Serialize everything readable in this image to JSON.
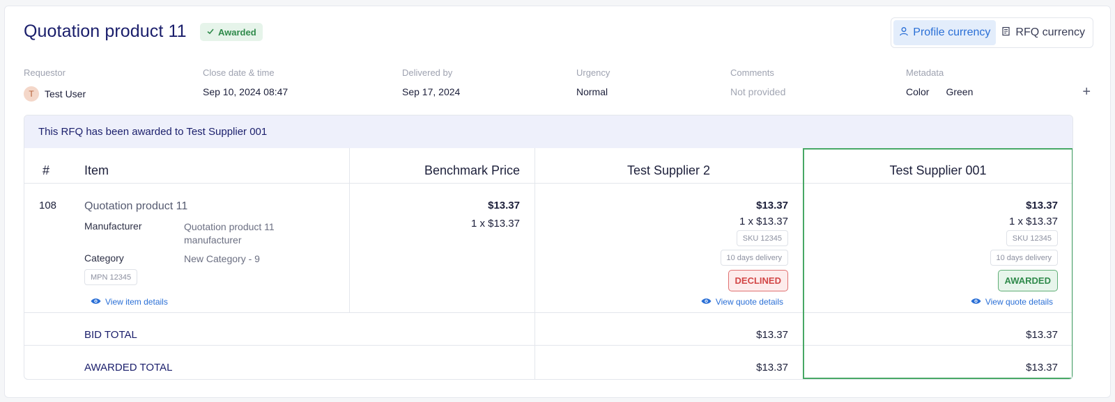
{
  "header": {
    "title": "Quotation product 11",
    "status_badge": "Awarded",
    "currency_toggle": {
      "profile": "Profile currency",
      "rfq": "RFQ currency"
    }
  },
  "meta": {
    "requestor": {
      "label": "Requestor",
      "avatar_initial": "T",
      "value": "Test User"
    },
    "close_date": {
      "label": "Close date & time",
      "value": "Sep 10, 2024 08:47"
    },
    "delivered_by": {
      "label": "Delivered by",
      "value": "Sep 17, 2024"
    },
    "urgency": {
      "label": "Urgency",
      "value": "Normal"
    },
    "comments": {
      "label": "Comments",
      "value": "Not provided"
    },
    "metadata": {
      "label": "Metadata",
      "key": "Color",
      "value": "Green",
      "add": "+"
    }
  },
  "banner": "This RFQ has been awarded to Test Supplier 001",
  "table": {
    "headers": {
      "num": "#",
      "item": "Item",
      "benchmark": "Benchmark Price",
      "supplier_a": "Test Supplier 2",
      "supplier_b": "Test Supplier 001"
    },
    "row": {
      "num": "108",
      "item_name": "Quotation product 11",
      "manufacturer_label": "Manufacturer",
      "manufacturer_line1": "Quotation product 11",
      "manufacturer_line2": "manufacturer",
      "category_label": "Category",
      "category_value": "New Category - 9",
      "mpn": "MPN 12345",
      "view_item": "View item details",
      "benchmark": {
        "price": "$13.37",
        "qty": "1 x $13.37"
      },
      "supplier_a": {
        "price": "$13.37",
        "qty": "1 x $13.37",
        "sku": "SKU 12345",
        "delivery": "10 days delivery",
        "status": "DECLINED",
        "view": "View quote details"
      },
      "supplier_b": {
        "price": "$13.37",
        "qty": "1 x $13.37",
        "sku": "SKU 12345",
        "delivery": "10 days delivery",
        "status": "AWARDED",
        "view": "View quote details"
      }
    },
    "bid_total": {
      "label": "BID TOTAL",
      "supplier_a": "$13.37",
      "supplier_b": "$13.37"
    },
    "awarded_total": {
      "label": "AWARDED TOTAL",
      "supplier_a": "$13.37",
      "supplier_b": "$13.37"
    }
  },
  "colors": {
    "accent": "#2a6fd6",
    "awarded_green": "#47a865",
    "declined_red": "#d24646",
    "title": "#1a1e6b"
  },
  "icons": [
    "check-icon",
    "user-icon",
    "receipt-icon",
    "plus-icon",
    "eye-icon"
  ]
}
